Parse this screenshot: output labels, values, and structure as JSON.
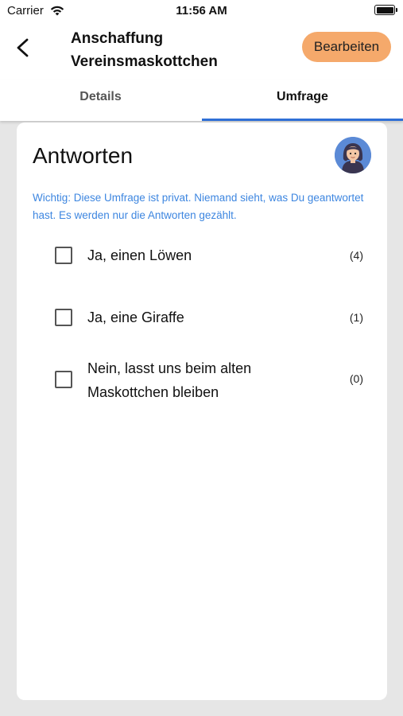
{
  "status_bar": {
    "carrier": "Carrier",
    "time": "11:56 AM"
  },
  "header": {
    "title": "Anschaffung Vereinsmaskottchen",
    "edit_label": "Bearbeiten"
  },
  "tabs": [
    {
      "label": "Details",
      "active": false
    },
    {
      "label": "Umfrage",
      "active": true
    }
  ],
  "card": {
    "title": "Antworten",
    "privacy_note": "Wichtig: Diese Umfrage ist privat. Niemand sieht, was Du geantwortet hast. Es werden nur die Antworten gezählt.",
    "options": [
      {
        "label": "Ja, einen Löwen",
        "count": "(4)",
        "checked": false
      },
      {
        "label": "Ja, eine Giraffe",
        "count": "(1)",
        "checked": false
      },
      {
        "label": "Nein, lasst uns beim alten Maskottchen bleiben",
        "count": "(0)",
        "checked": false
      }
    ]
  },
  "colors": {
    "accent": "#2f6fd6",
    "edit_button": "#f5a96b",
    "note_text": "#3d86e0"
  }
}
